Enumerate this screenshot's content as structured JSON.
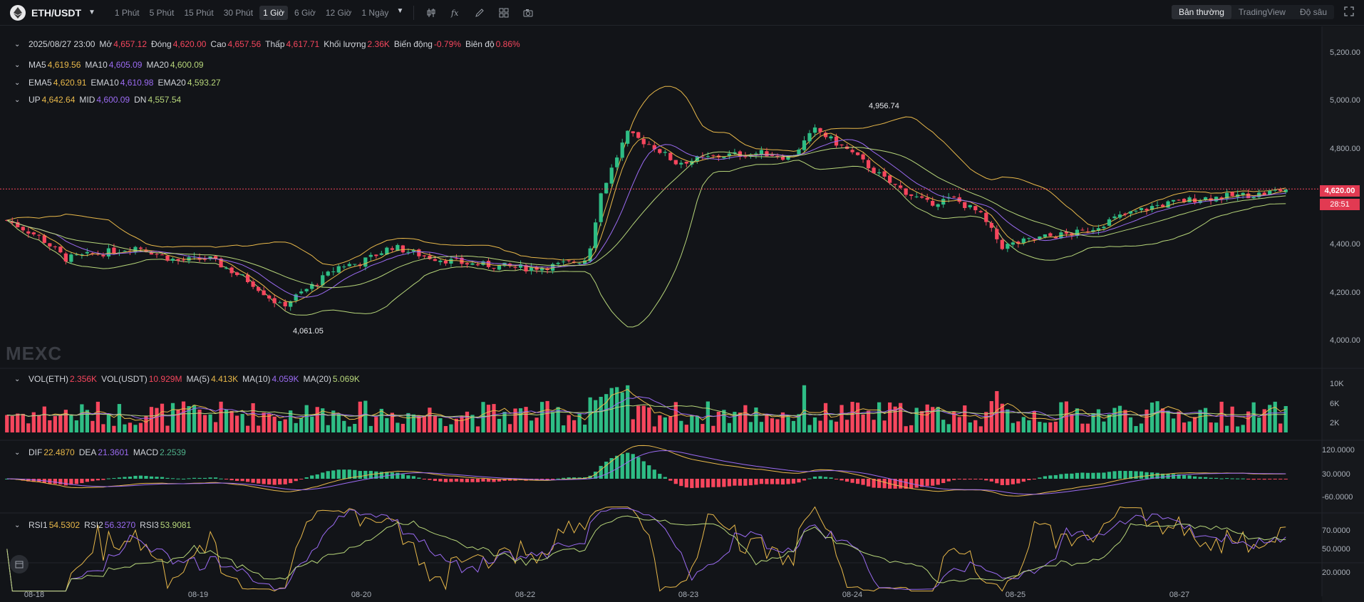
{
  "toolbar": {
    "pair": "ETH/USDT",
    "intervals": [
      "1 Phút",
      "5 Phút",
      "15 Phút",
      "30 Phút",
      "1 Giờ",
      "6 Giờ",
      "12 Giờ",
      "1 Ngày"
    ],
    "active_interval": "1 Giờ",
    "views": [
      "Bản thường",
      "TradingView",
      "Độ sâu"
    ],
    "active_view": "Bản thường"
  },
  "ohlc": {
    "date": "2025/08/27 23:00",
    "open_label": "Mở",
    "open": "4,657.12",
    "close_label": "Đóng",
    "close": "4,620.00",
    "high_label": "Cao",
    "high": "4,657.56",
    "low_label": "Thấp",
    "low": "4,617.71",
    "volume_label": "Khối lượng",
    "volume": "2.36K",
    "change_label": "Biến động",
    "change": "-0.79%",
    "amplitude_label": "Biên độ",
    "amplitude": "0.86%"
  },
  "ma": {
    "ma5_label": "MA5",
    "ma5": "4,619.56",
    "ma10_label": "MA10",
    "ma10": "4,605.09",
    "ma20_label": "MA20",
    "ma20": "4,600.09"
  },
  "ema": {
    "ema5_label": "EMA5",
    "ema5": "4,620.91",
    "ema10_label": "EMA10",
    "ema10": "4,610.98",
    "ema20_label": "EMA20",
    "ema20": "4,593.27"
  },
  "boll": {
    "up_label": "UP",
    "up": "4,642.64",
    "mid_label": "MID",
    "mid": "4,600.09",
    "dn_label": "DN",
    "dn": "4,557.54"
  },
  "vol": {
    "eth_label": "VOL(ETH)",
    "eth": "2.356K",
    "usdt_label": "VOL(USDT)",
    "usdt": "10.929M",
    "ma5_label": "MA(5)",
    "ma5": "4.413K",
    "ma10_label": "MA(10)",
    "ma10": "4.059K",
    "ma20_label": "MA(20)",
    "ma20": "5.069K"
  },
  "macd": {
    "dif_label": "DIF",
    "dif": "22.4870",
    "dea_label": "DEA",
    "dea": "21.3601",
    "macd_label": "MACD",
    "macd": "2.2539"
  },
  "rsi": {
    "rsi1_label": "RSI1",
    "rsi1": "54.5302",
    "rsi2_label": "RSI2",
    "rsi2": "56.3270",
    "rsi3_label": "RSI3",
    "rsi3": "53.9081"
  },
  "axes": {
    "price_ticks": [
      "5,200.00",
      "5,000.00",
      "4,800.00",
      "4,400.00",
      "4,200.00",
      "4,000.00"
    ],
    "vol_ticks": [
      "10K",
      "6K",
      "2K"
    ],
    "macd_ticks": [
      "120.0000",
      "30.0000",
      "-60.0000"
    ],
    "rsi_ticks": [
      "70.0000",
      "50.0000",
      "20.0000"
    ],
    "dates": [
      "08-18",
      "08-19",
      "08-20",
      "08-22",
      "08-23",
      "08-24",
      "08-25",
      "08-27"
    ]
  },
  "current_price": "4,620.00",
  "countdown": "28:51",
  "high_marker": "4,956.74",
  "low_marker": "4,061.05",
  "watermark": "MEXC",
  "colors": {
    "up": "#2ebd85",
    "down": "#f6465d",
    "ma5": "#e8b84a",
    "ma10": "#9b6bf2",
    "ma20": "#b7d67a",
    "bg": "#121418"
  },
  "chart_data": {
    "type": "candlestick",
    "symbol": "ETH/USDT",
    "interval": "1 Giờ",
    "ylim": [
      4000,
      5200
    ],
    "x": [
      "08-18",
      "08-19",
      "08-20",
      "08-22",
      "08-23",
      "08-24",
      "08-25",
      "08-27"
    ],
    "close_by_date": [
      4470,
      4330,
      4280,
      4300,
      4750,
      4760,
      4420,
      4610
    ],
    "high": 4956.74,
    "low": 4061.05,
    "last": 4620.0
  }
}
